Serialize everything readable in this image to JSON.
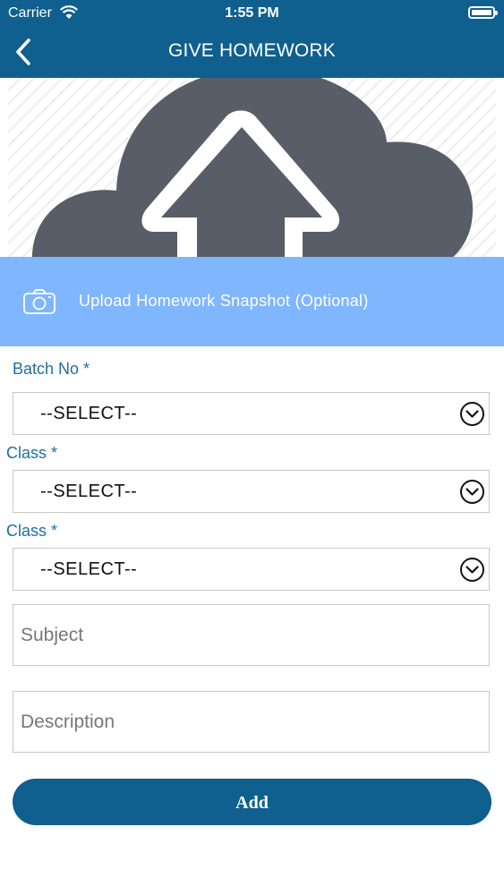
{
  "status_bar": {
    "carrier": "Carrier",
    "time": "1:55 PM"
  },
  "header": {
    "title": "GIVE HOMEWORK",
    "back_icon": "chevron-left-icon"
  },
  "hero": {
    "icon": "cloud-upload-icon"
  },
  "upload": {
    "label": "Upload Homework Snapshot (Optional)",
    "icon": "camera-icon"
  },
  "form": {
    "batch": {
      "label": "Batch No *",
      "value": "--SELECT--"
    },
    "class1": {
      "label": "Class *",
      "value": "--SELECT--"
    },
    "class2": {
      "label": "Class *",
      "value": "--SELECT--"
    },
    "subject": {
      "placeholder": "Subject",
      "value": ""
    },
    "description": {
      "placeholder": "Description",
      "value": ""
    },
    "submit_label": "Add"
  },
  "colors": {
    "primary": "#0f5f8f",
    "accent_light": "#80b6fd",
    "label": "#1e6f9f",
    "cloud": "#585d68"
  }
}
